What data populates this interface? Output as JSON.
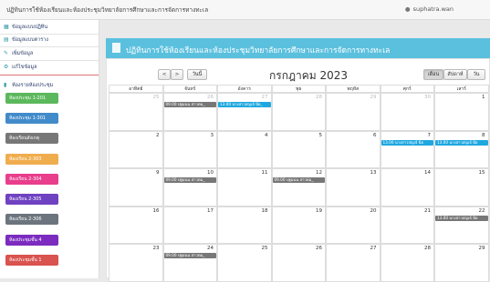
{
  "header": {
    "app_title": "ปฏิทินการใช้ห้องเรียนและห้องประชุมวิทยาลัยการศึกษาและการจัดการทางทะเล",
    "user_name": "suphatra.wan"
  },
  "sidebar": {
    "nav": [
      {
        "label": "ข้อมูลแบบปฏิทิน",
        "icon": "calendar-icon"
      },
      {
        "label": "ข้อมูลแบบตาราง",
        "icon": "table-icon"
      },
      {
        "label": "เพิ่มข้อมูล",
        "icon": "edit-icon"
      },
      {
        "label": "แก้ไขข้อมูล",
        "icon": "gear-icon"
      }
    ],
    "section_label": "ห้องรายห้องประชุม",
    "rooms": [
      {
        "label": "ห้องประชุม 1-201",
        "color": "#5cb85c"
      },
      {
        "label": "ห้องประชุม 1-301",
        "color": "#428bca"
      },
      {
        "label": "ห้องเรียนสังเกตุ",
        "color": "#777777"
      },
      {
        "label": "ห้องเรียน 2-303",
        "color": "#f0ad4e"
      },
      {
        "label": "ห้องเรียน 2-304",
        "color": "#e83e8c"
      },
      {
        "label": "ห้องเรียน 2-305",
        "color": "#6f42c1"
      },
      {
        "label": "ห้องเรียน 2-306",
        "color": "#6c757d"
      },
      {
        "label": "ห้องประชุมชั้น 4",
        "color": "#7b2cbf"
      },
      {
        "label": "ห้องประชุมชั้น 1",
        "color": "#d9534f"
      }
    ]
  },
  "banner": {
    "title": "ปฏิทินการใช้ห้องเรียนและห้องประชุมวิทยาลัยการศึกษาและการจัดการทางทะเล"
  },
  "calendar": {
    "title": "กรกฎาคม 2023",
    "prev_label": "<",
    "next_label": ">",
    "today_label": "วันนี้",
    "views": [
      "เดือน",
      "สัปดาห์",
      "วัน"
    ],
    "weekdays": [
      "อาทิตย์",
      "จันทร์",
      "อังคาร",
      "พุธ",
      "พฤหัส",
      "ศุกร์",
      "เสาร์"
    ],
    "weeks": [
      [
        25,
        26,
        27,
        28,
        29,
        30,
        1
      ],
      [
        2,
        3,
        4,
        5,
        6,
        7,
        8
      ],
      [
        9,
        10,
        11,
        12,
        13,
        14,
        15
      ],
      [
        16,
        17,
        18,
        19,
        20,
        21,
        22
      ],
      [
        23,
        24,
        25,
        26,
        27,
        28,
        29
      ]
    ],
    "events": [
      {
        "week": 0,
        "day": 1,
        "text": "09.00 ปฐมนน สาวตม_",
        "color": "#777777"
      },
      {
        "week": 0,
        "day": 2,
        "text": "13.00 นางสาวสญเจ้ นีย_",
        "color": "#1fa8e0"
      },
      {
        "week": 1,
        "day": 5,
        "text": "13.00 นางสาวสญเจ้ นีย",
        "color": "#1fa8e0"
      },
      {
        "week": 1,
        "day": 6,
        "text": "13.00 นางสาวสญเจ้ นีย",
        "color": "#1fa8e0"
      },
      {
        "week": 2,
        "day": 1,
        "text": "09.00 ปฐมนน สาวตม_",
        "color": "#777777"
      },
      {
        "week": 2,
        "day": 3,
        "text": "09.00 ปฐมนน สาวตม_",
        "color": "#777777"
      },
      {
        "week": 3,
        "day": 6,
        "text": "13.00 นางสาวสญเจ้ นีย",
        "color": "#777777"
      },
      {
        "week": 4,
        "day": 1,
        "text": "09.00 ปฐมนน สาวตม_",
        "color": "#777777"
      }
    ]
  }
}
